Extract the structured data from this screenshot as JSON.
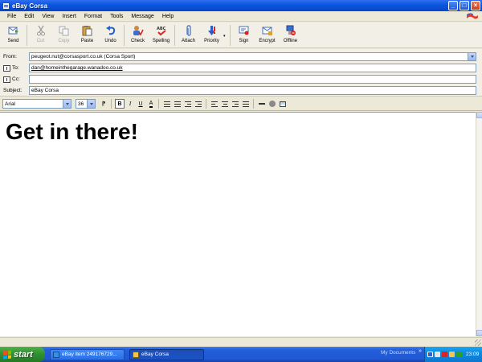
{
  "window": {
    "title": "eBay Corsa"
  },
  "menu": [
    "File",
    "Edit",
    "View",
    "Insert",
    "Format",
    "Tools",
    "Message",
    "Help"
  ],
  "toolbar": {
    "send": "Send",
    "cut": "Cut",
    "copy": "Copy",
    "paste": "Paste",
    "undo": "Undo",
    "check": "Check",
    "spelling": "Spelling",
    "attach": "Attach",
    "priority": "Priority",
    "sign": "Sign",
    "encrypt": "Encrypt",
    "offline": "Offline"
  },
  "headers": {
    "from_label": "From:",
    "to_label": "To:",
    "cc_label": "Cc:",
    "subject_label": "Subject:",
    "from_value": "peugeot.nut@corsasport.co.uk    (Corsa Sport)",
    "to_value": "dan@homeinthegarage.wanadoo.co.uk",
    "cc_value": "",
    "subject_value": "eBay Corsa"
  },
  "format": {
    "font": "Arial",
    "size": "36"
  },
  "message": {
    "body": "Get in there!"
  },
  "taskbar": {
    "start": "start",
    "tasks": [
      "eBay item 249176729...",
      "eBay Corsa"
    ],
    "my_documents": "My Documents",
    "chevron": "»",
    "clock": "23:09"
  },
  "colors": {
    "titlebar": "#0a55dd",
    "start": "#2f8f2f",
    "taskbar": "#245edb",
    "tray": "#0f8ae0"
  }
}
